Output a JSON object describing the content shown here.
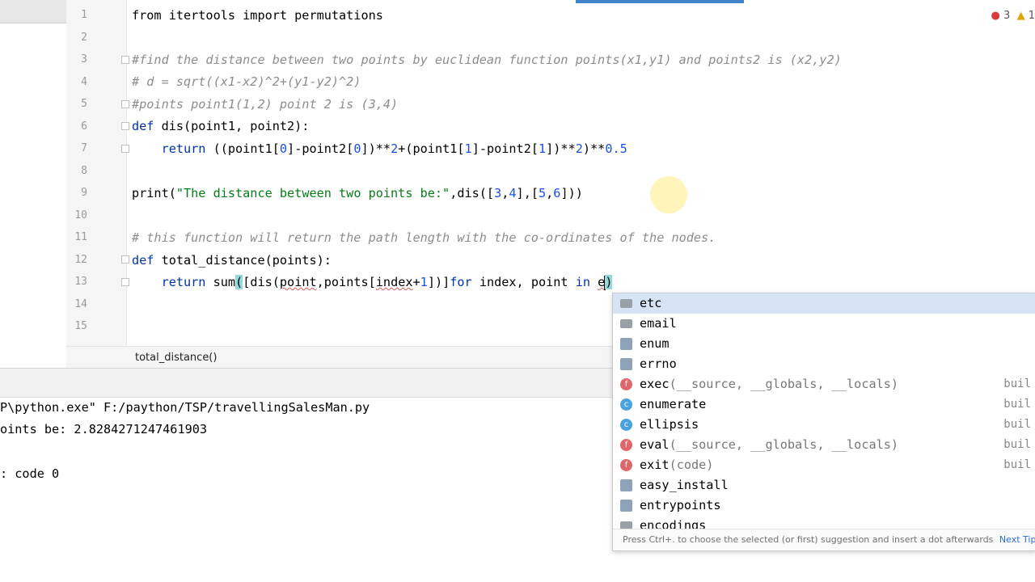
{
  "editor": {
    "problems": {
      "errors": "3",
      "warnings": "1"
    },
    "line_numbers": [
      "1",
      "2",
      "3",
      "4",
      "5",
      "6",
      "7",
      "8",
      "9",
      "10",
      "11",
      "12",
      "13",
      "14",
      "15"
    ],
    "lines": {
      "l1": "from itertools import permutations",
      "l3": "#find the distance between two points by euclidean function points(x1,y1) and points2 is (x2,y2)",
      "l4": "# d = sqrt((x1-x2)^2+(y1-y2)^2)",
      "l5": "#points point1(1,2) point 2 is (3,4)",
      "l6_kw": "def",
      "l6_rest": " dis(point1, point2):",
      "l7_kw": "return",
      "l7_a": " ((point1[",
      "l7_n1": "0",
      "l7_b": "]-point2[",
      "l7_n2": "0",
      "l7_c": "])**",
      "l7_n3": "2",
      "l7_d": "+(point1[",
      "l7_n4": "1",
      "l7_e": "]-point2[",
      "l7_n5": "1",
      "l7_f": "])**",
      "l7_n6": "2",
      "l7_g": ")**",
      "l7_n7": "0.5",
      "l9_a": "print(",
      "l9_str": "\"The distance between two points be:\"",
      "l9_b": ",dis([",
      "l9_n1": "3",
      "l9_c": ",",
      "l9_n2": "4",
      "l9_d": "],[",
      "l9_n3": "5",
      "l9_e": ",",
      "l9_n4": "6",
      "l9_f": "]))",
      "l11": "# this function will return the path length with the co-ordinates of the nodes.",
      "l12_kw": "def",
      "l12_rest": " total_distance(points):",
      "l13_kw": "return",
      "l13_a": " sum",
      "l13_paren": "(",
      "l13_b": "[dis(",
      "l13_point": "point",
      "l13_c": ",points[",
      "l13_index": "index",
      "l13_d": "+",
      "l13_n": "1",
      "l13_e": "])]",
      "l13_for": "for",
      "l13_f": " index, point ",
      "l13_in": "in",
      "l13_g": " ",
      "l13_typed": "e",
      "l13_close": ")"
    },
    "breadcrumb": "total_distance()"
  },
  "console": {
    "line1": "P\\python.exe\" F:/paython/TSP/travellingSalesMan.py",
    "line2": "oints be: 2.8284271247461903",
    "line3": ": code 0"
  },
  "completion": {
    "items": [
      {
        "name": "etc",
        "sig": "",
        "tail": "",
        "icon": "folder-icon"
      },
      {
        "name": "email",
        "sig": "",
        "tail": "",
        "icon": "package-icon"
      },
      {
        "name": "enum",
        "sig": "",
        "tail": "",
        "icon": "module-icon"
      },
      {
        "name": "errno",
        "sig": "",
        "tail": "",
        "icon": "module-icon"
      },
      {
        "name": "exec",
        "sig": "(__source, __globals, __locals)",
        "tail": "buil",
        "icon": "function-icon"
      },
      {
        "name": "enumerate",
        "sig": "",
        "tail": "buil",
        "icon": "class-icon"
      },
      {
        "name": "ellipsis",
        "sig": "",
        "tail": "buil",
        "icon": "class-icon"
      },
      {
        "name": "eval",
        "sig": "(__source, __globals, __locals)",
        "tail": "buil",
        "icon": "function-icon"
      },
      {
        "name": "exit",
        "sig": "(code)",
        "tail": "buil",
        "icon": "function-icon"
      },
      {
        "name": "easy_install",
        "sig": "",
        "tail": "",
        "icon": "module-icon"
      },
      {
        "name": "entrypoints",
        "sig": "",
        "tail": "",
        "icon": "module-icon"
      },
      {
        "name": "encodings",
        "sig": "",
        "tail": "",
        "icon": "folder-icon"
      }
    ],
    "footer_text": "Press Ctrl+. to choose the selected (or first) suggestion and insert a dot afterwards",
    "footer_link": "Next Tip"
  },
  "colors": {
    "keyword": "#0033b3",
    "number": "#1750eb",
    "string": "#067d17",
    "comment": "#8c8c8c",
    "selection": "#d5e3f5"
  }
}
